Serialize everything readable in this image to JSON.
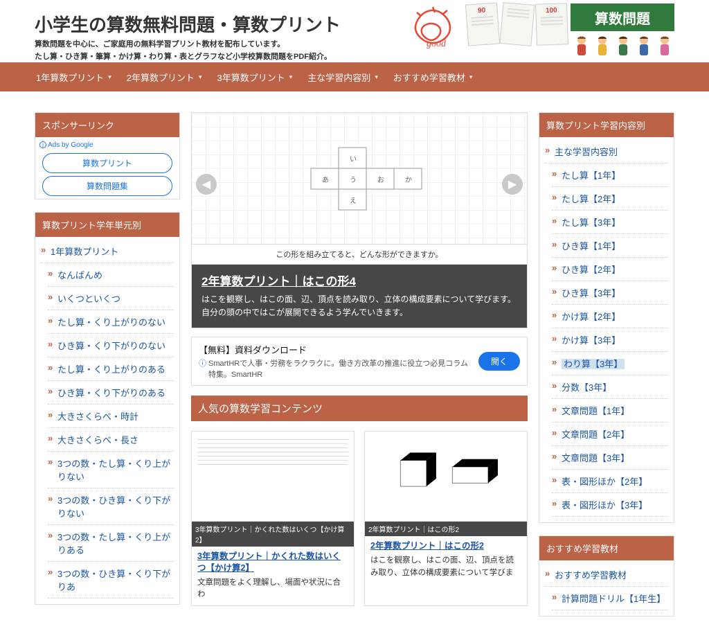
{
  "header": {
    "title": "小学生の算数無料問題・算数プリント",
    "tagline1": "算数問題を中心に、ご家庭用の無料学習プリント教材を配布しています。",
    "tagline2": "たし算・ひき算・筆算・かけ算・わり算・表とグラフなど小学校算数問題をPDF紹介。",
    "badge": "算数問題",
    "scribble_text": "good",
    "scores": [
      "90",
      "",
      "100"
    ]
  },
  "nav": [
    "1年算数プリント",
    "2年算数プリント",
    "3年算数プリント",
    "主な学習内容別",
    "おすすめ学習教材"
  ],
  "left": {
    "sponsor_title": "スポンサーリンク",
    "ads_by": "Ads by Google",
    "ad_links": [
      "算数プリント",
      "算数問題集"
    ],
    "units_title": "算数プリント学年単元別",
    "units_top": "1年算数プリント",
    "units": [
      "なんばんめ",
      "いくつといくつ",
      "たし算・くり上がりのない",
      "ひき算・くり下がりのない",
      "たし算・くり上がりのある",
      "ひき算・くり下がりのある",
      "大きさくらべ・時計",
      "大きさくらべ・長さ",
      "3つの数・たし算・くり上がりない",
      "3つの数・ひき算・くり下がりない",
      "3つの数・たし算・くり上がりある",
      "3つの数・ひき算・くり下がりあ"
    ]
  },
  "slider": {
    "caption": "この形を組み立てると、どんな形ができますか。",
    "title": "2年算数プリント｜はこの形4",
    "desc": "はこを観察し、はこの面、辺、頂点を読み取り、立体の構成要素について学びます。自分の頭の中ではこが展開できるよう学んでいきます。",
    "labels": [
      "あ",
      "い",
      "う",
      "え",
      "お",
      "か"
    ]
  },
  "inline_ad": {
    "headline": "【無料】資料ダウンロード",
    "sub": "SmartHRで人事・労務をラクラクに。働き方改革の推進に役立つ必見コラム特集。SmartHR",
    "button": "開く"
  },
  "popular_title": "人気の算数学習コンテンツ",
  "cards": [
    {
      "bar": "3年算数プリント｜かくれた数はいくつ【かけ算2】",
      "title": "3年算数プリント｜かくれた数はいくつ【かけ算2】",
      "desc": "文章問題をよく理解し、場面や状況に合わ"
    },
    {
      "bar": "2年算数プリント｜はこの形2",
      "title": "2年算数プリント｜はこの形2",
      "desc": "はこを観察し、はこの面、辺、頂点を読み取り、立体の構成要素について学びま"
    }
  ],
  "right": {
    "cat_title": "算数プリント学習内容別",
    "cat_top": "主な学習内容別",
    "cats": [
      "たし算【1年】",
      "たし算【2年】",
      "たし算【3年】",
      "ひき算【1年】",
      "ひき算【2年】",
      "ひき算【3年】",
      "かけ算【2年】",
      "かけ算【3年】",
      "わり算【3年】",
      "分数【3年】",
      "文章問題【1年】",
      "文章問題【2年】",
      "文章問題【3年】",
      "表・図形ほか【2年】",
      "表・図形ほか【3年】"
    ],
    "highlight_index": 8,
    "rec_title": "おすすめ学習教材",
    "rec_top": "おすすめ学習教材",
    "recs": [
      "計算問題ドリル【1年生】"
    ]
  }
}
